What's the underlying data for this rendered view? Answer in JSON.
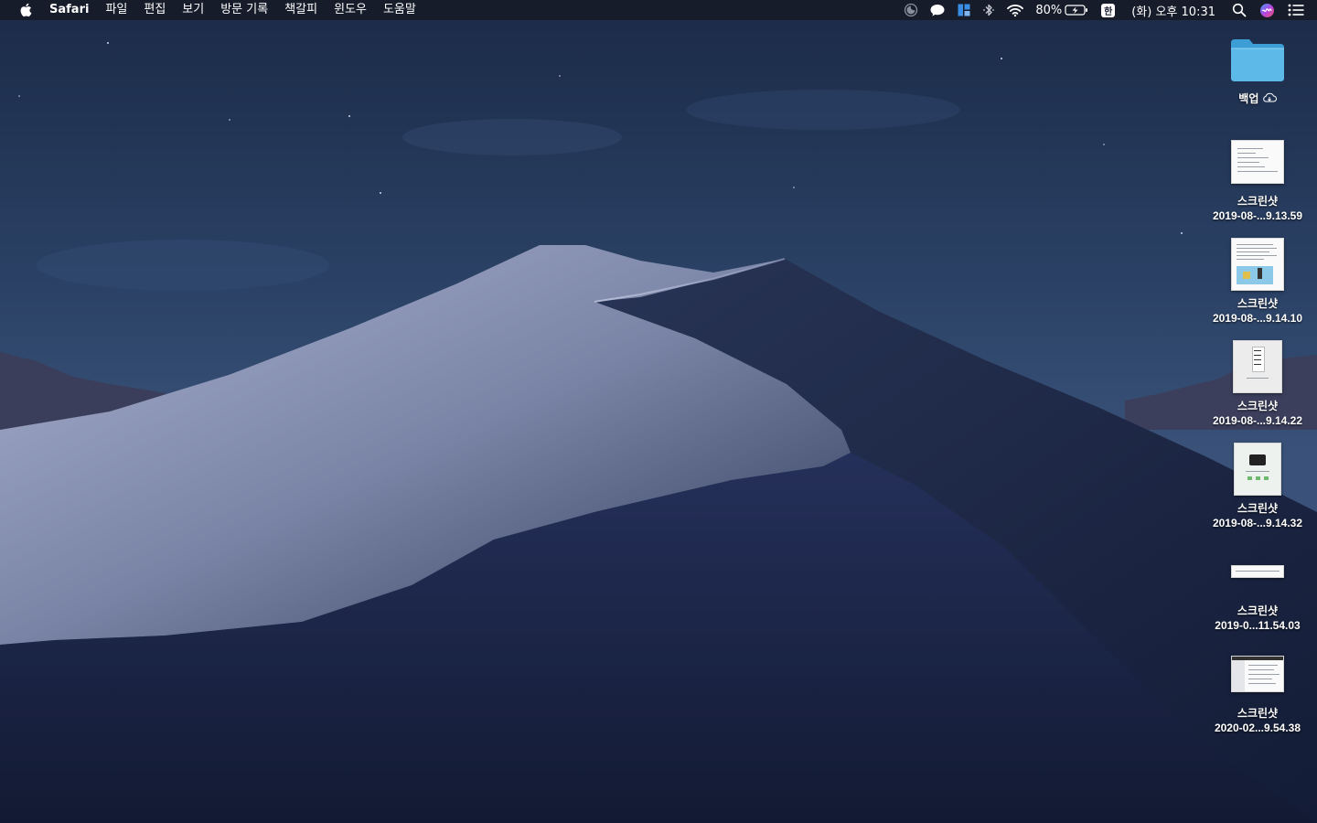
{
  "menubar": {
    "app_name": "Safari",
    "menus": [
      "파일",
      "편집",
      "보기",
      "방문 기록",
      "책갈피",
      "윈도우",
      "도움말"
    ],
    "battery_percent": "80%",
    "input_source": "한",
    "clock": "(화) 오후 10:31",
    "status_icons": [
      "do-not-disturb-icon",
      "messages-icon",
      "magnet-icon",
      "bluetooth-icon",
      "wifi-icon",
      "battery-charging-icon",
      "input-source-icon",
      "search-icon",
      "siri-icon",
      "notification-center-icon"
    ]
  },
  "desktop": {
    "items": [
      {
        "kind": "folder",
        "name": "백업",
        "cloud": true
      },
      {
        "kind": "screenshot",
        "line1": "스크린샷",
        "line2": "2019-08-...9.13.59"
      },
      {
        "kind": "screenshot",
        "line1": "스크린샷",
        "line2": "2019-08-...9.14.10"
      },
      {
        "kind": "screenshot",
        "line1": "스크린샷",
        "line2": "2019-08-...9.14.22"
      },
      {
        "kind": "screenshot",
        "line1": "스크린샷",
        "line2": "2019-08-...9.14.32"
      },
      {
        "kind": "screenshot",
        "line1": "스크린샷",
        "line2": "2019-0...11.54.03"
      },
      {
        "kind": "screenshot",
        "line1": "스크린샷",
        "line2": "2020-02...9.54.38"
      }
    ]
  },
  "colors": {
    "menubar_bg": "#161a26",
    "sky": "#2b4266",
    "dune_light": "#9ea7c7",
    "dune_dark": "#1b2647",
    "folder": "#5cb9e8"
  }
}
